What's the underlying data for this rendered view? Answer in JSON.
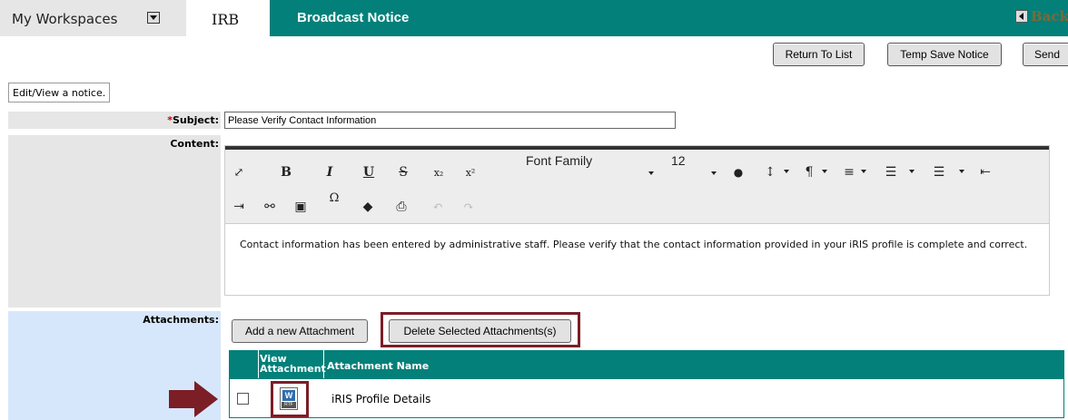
{
  "topnav": {
    "workspaces_label": "My Workspaces",
    "module_label": "IRB",
    "page_title": "Broadcast Notice",
    "back_label": "Back"
  },
  "actions": {
    "return_label": "Return To List",
    "temp_save_label": "Temp Save Notice",
    "send_label": "Send"
  },
  "help_text": "Edit/View a notice.",
  "form": {
    "subject_required_mark": "*",
    "subject_label": "Subject:",
    "subject_value": "Please Verify Contact Information",
    "content_label": "Content:",
    "attachments_label": "Attachments:"
  },
  "editor": {
    "font_family": "Font Family",
    "font_size": "12",
    "body_text": "Contact information has been entered by administrative staff. Please verify that the contact information provided in your iRIS profile is complete and correct."
  },
  "attachments": {
    "add_label": "Add a new Attachment",
    "delete_label": "Delete Selected Attachments(s)",
    "columns": {
      "view_attachment": "View Attachment",
      "name": "Attachment Name"
    },
    "rows": [
      {
        "name": "iRIS Profile Details",
        "icon_letter": "W",
        "icon_type": "RTF"
      }
    ]
  },
  "colors": {
    "teal": "#028079",
    "highlight": "#7b1e26",
    "attach_bg": "#d7e7fb"
  }
}
